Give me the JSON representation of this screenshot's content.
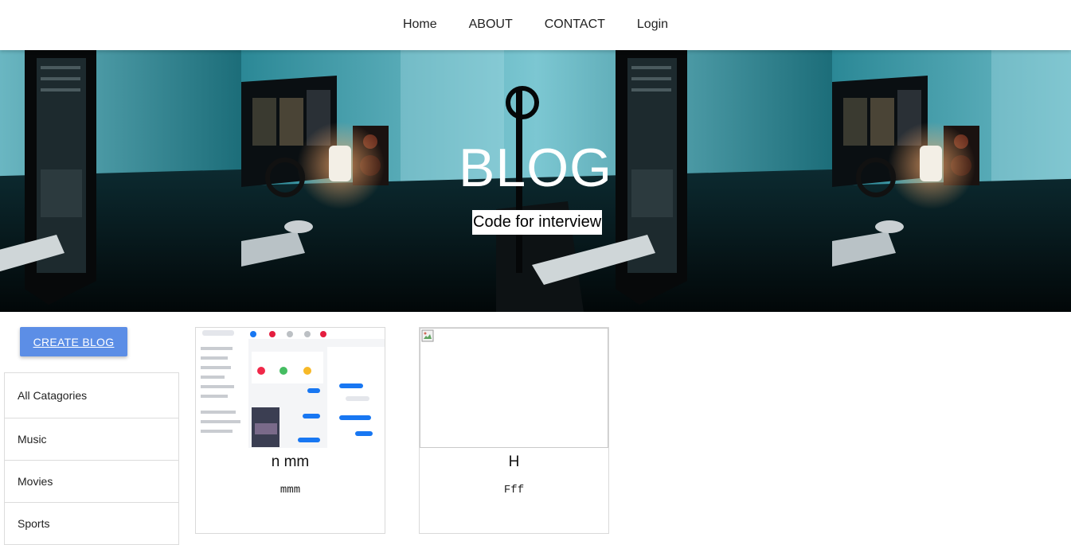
{
  "nav": {
    "links": [
      "Home",
      "ABOUT",
      "CONTACT",
      "Login"
    ]
  },
  "hero": {
    "title": "BLOG",
    "subtitle": "Code for interview"
  },
  "sidebar": {
    "create_label": "CREATE BLOG",
    "categories": [
      "All Catagories",
      "Music",
      "Movies",
      "Sports"
    ]
  },
  "posts": [
    {
      "title": "n mm",
      "description": "mmm",
      "image": "messenger-screenshot"
    },
    {
      "title": "H",
      "description": "Fff",
      "image": "broken-image-icon"
    }
  ],
  "colors": {
    "accent_button": "#5c8ee6",
    "hero_teal": "#1b7f8f",
    "navbar_bg": "#ffffff"
  }
}
